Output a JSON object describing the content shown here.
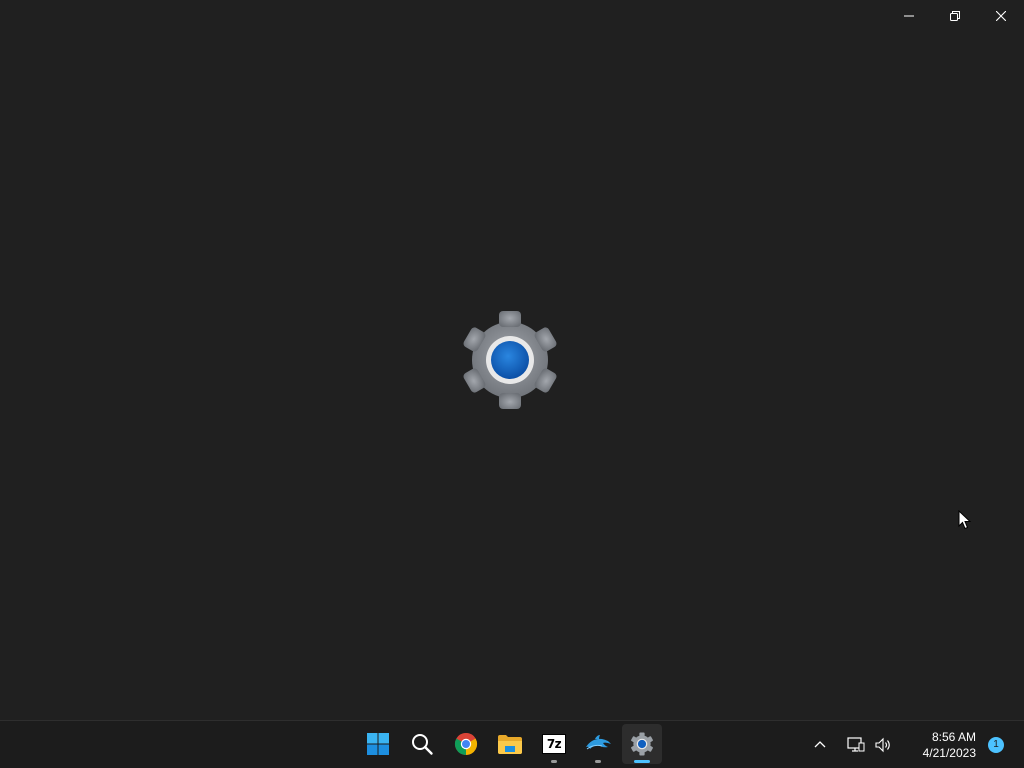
{
  "window": {
    "minimize_icon": "minimize-icon",
    "restore_icon": "restore-icon",
    "close_icon": "close-icon",
    "splash_icon": "settings-gear-icon"
  },
  "taskbar": {
    "apps": [
      {
        "name": "start",
        "icon": "windows-start-icon"
      },
      {
        "name": "search",
        "icon": "search-icon"
      },
      {
        "name": "chrome",
        "icon": "chrome-icon"
      },
      {
        "name": "file-explorer",
        "icon": "folder-icon"
      },
      {
        "name": "7zip",
        "icon": "7zip-icon",
        "label": "7z",
        "running": true
      },
      {
        "name": "dolphin",
        "icon": "dolphin-icon",
        "running": true
      },
      {
        "name": "settings",
        "icon": "settings-icon",
        "running": true,
        "focused": true
      }
    ],
    "tray": {
      "chevron_icon": "chevron-up-icon",
      "network_icon": "network-icon",
      "volume_icon": "volume-icon",
      "time": "8:56 AM",
      "date": "4/21/2023",
      "notification_count": "1"
    }
  },
  "colors": {
    "background": "#202020",
    "taskbar": "#1c1c1c",
    "accent": "#4cc2ff",
    "gear_gray": "#8a8d92",
    "gear_center": "#1060c0"
  }
}
